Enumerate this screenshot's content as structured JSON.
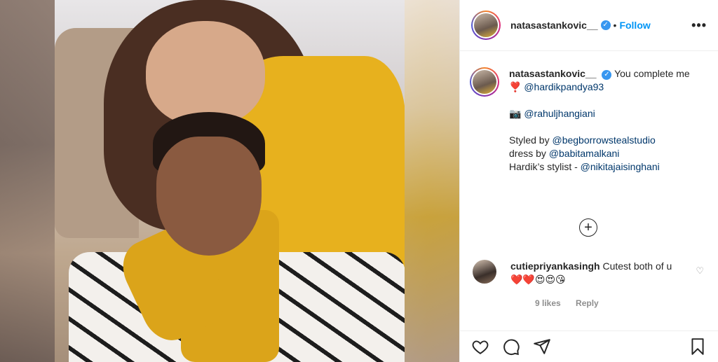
{
  "post": {
    "username": "natasastankovic__",
    "follow_label": "Follow",
    "dot": "•",
    "verified_glyph": "✓",
    "more_label": "•••"
  },
  "caption": {
    "username": "natasastankovic__",
    "text": "You complete me",
    "heart": "❣️",
    "mention_partner": "@hardikpandya93",
    "camera": "📷",
    "mention_photographer": "@rahuljhangiani",
    "styled_prefix": "Styled by ",
    "mention_stylist": "@begborrowstealstudio",
    "dress_prefix": "dress by ",
    "mention_dress": "@babitamalkani",
    "hardik_prefix": "Hardik’s stylist - ",
    "mention_hardik_stylist": "@nikitajaisinghani"
  },
  "load_more_label": "+",
  "comment": {
    "username": "cutiepriyankasingh",
    "text": "Cutest both of u",
    "emojis": "❤️❤️😍😍😘",
    "likes": "9 likes",
    "reply_label": "Reply",
    "like_icon": "♡"
  },
  "actions": {
    "icons": [
      "heart-icon",
      "comment-icon",
      "share-icon",
      "bookmark-icon"
    ]
  }
}
